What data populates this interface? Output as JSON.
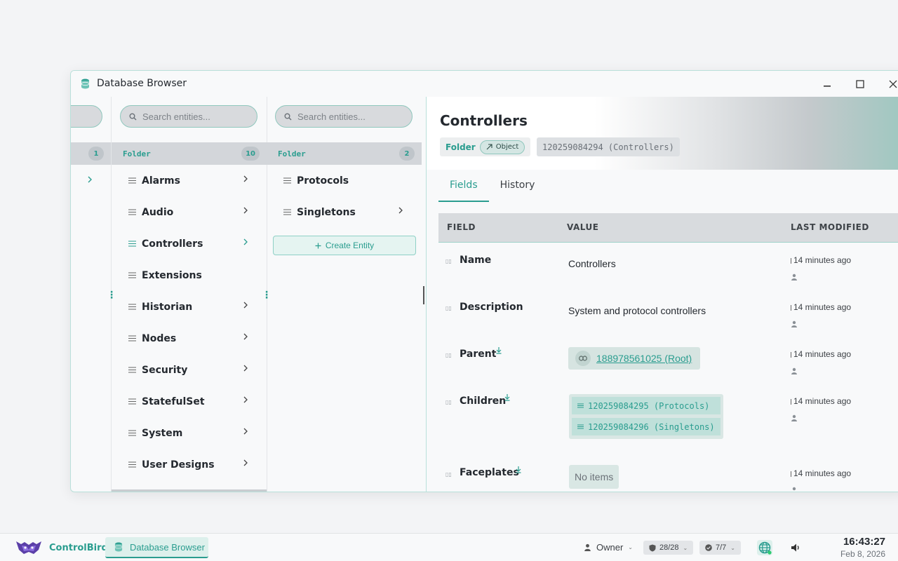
{
  "window": {
    "title": "Database Browser"
  },
  "columns": [
    {
      "count": "1"
    },
    {
      "search_placeholder": "Search entities...",
      "type": "Folder",
      "count": "10",
      "items": [
        {
          "label": "Alarms",
          "has_children": true
        },
        {
          "label": "Audio",
          "has_children": true
        },
        {
          "label": "Controllers",
          "has_children": true,
          "selected": true
        },
        {
          "label": "Extensions",
          "has_children": false
        },
        {
          "label": "Historian",
          "has_children": true
        },
        {
          "label": "Nodes",
          "has_children": true
        },
        {
          "label": "Security",
          "has_children": true
        },
        {
          "label": "StatefulSet",
          "has_children": true
        },
        {
          "label": "System",
          "has_children": true
        },
        {
          "label": "User Designs",
          "has_children": true
        }
      ]
    },
    {
      "search_placeholder": "Search entities...",
      "type": "Folder",
      "count": "2",
      "items": [
        {
          "label": "Protocols",
          "has_children": false
        },
        {
          "label": "Singletons",
          "has_children": true
        }
      ],
      "create_label": "Create Entity"
    }
  ],
  "detail": {
    "title": "Controllers",
    "type": "Folder",
    "kind": "Object",
    "id_label": "120259084294 (Controllers)",
    "tabs": [
      "Fields",
      "History"
    ],
    "active_tab": "Fields",
    "table_headers": {
      "field": "FIELD",
      "value": "VALUE",
      "modified": "LAST MODIFIED"
    },
    "rows": [
      {
        "field": "Name",
        "value": "Controllers",
        "modified": "14 minutes ago"
      },
      {
        "field": "Description",
        "value": "System and protocol controllers",
        "modified": "14 minutes ago"
      },
      {
        "field": "Parent",
        "ref": "188978561025 (Root)",
        "modified": "14 minutes ago"
      },
      {
        "field": "Children",
        "children": [
          "120259084295 (Protocols)",
          "120259084296 (Singletons)"
        ],
        "modified": "14 minutes ago"
      },
      {
        "field": "Faceplates",
        "empty_label": "No items",
        "modified": "14 minutes ago"
      }
    ]
  },
  "taskbar": {
    "brand": "ControlBird",
    "active_app": "Database Browser",
    "user": "Owner",
    "shield_status": "28/28",
    "check_status": "7/7",
    "time": "16:43:27",
    "date": "Feb 8, 2026"
  },
  "colors": {
    "accent": "#2a9d8f",
    "header_bg": "#d3d6da",
    "window_border": "#b9e0da"
  },
  "icons": [
    "database-icon",
    "minimize-icon",
    "maximize-icon",
    "close-icon",
    "search-icon",
    "list-icon",
    "chevron-right-icon",
    "plus-icon",
    "arrow-up-right-icon",
    "link-icon",
    "pin-icon",
    "user-icon",
    "owl-logo-icon",
    "shield-icon",
    "check-circle-icon",
    "globe-icon",
    "volume-icon"
  ]
}
